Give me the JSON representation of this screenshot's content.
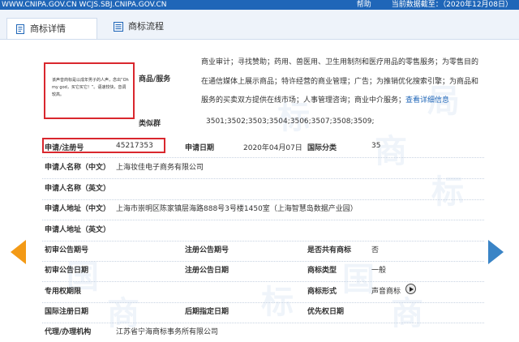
{
  "topbar": {
    "sites": "WWW.CNIPA.GOV.CN WCJS.SBJ.CNIPA.GOV.CN",
    "help": "帮助",
    "data_date": "当前数据截至：（2020年12月08日）"
  },
  "tabs": [
    {
      "label": "商标详情",
      "icon": "document-icon"
    },
    {
      "label": "商标流程",
      "icon": "list-icon"
    }
  ],
  "watermark": {
    "chars": [
      "标",
      "局",
      "商",
      "标",
      "国",
      "商",
      "标",
      "国",
      "商"
    ]
  },
  "trademark": {
    "sound_description": "该声音商标是以成年男子的人声，念出“Oh my god，买它买它！”。语速较快，音调较高。",
    "goods_label": "商品/服务",
    "goods_text": "商业审计；寻找赞助；药用、兽医用、卫生用制剂和医疗用品的零售服务；为零售目的在通信媒体上展示商品；特许经营的商业管理；广告；为推销优化搜索引擎；为商品和服务的买卖双方提供在线市场；人事管理咨询；商业中介服务；",
    "goods_link": "查看详细信息",
    "similar_group_label": "类似群",
    "similar_group_value": "3501;3502;3503;3504;3506;3507;3508;3509;",
    "reg_no_label": "申请/注册号",
    "reg_no_value": "45217353",
    "app_date_label": "申请日期",
    "app_date_value": "2020年04月07日",
    "intl_class_label": "国际分类",
    "intl_class_value": "35",
    "applicant_cn_label": "申请人名称（中文）",
    "applicant_cn_value": "上海妆佳电子商务有限公司",
    "applicant_en_label": "申请人名称（英文）",
    "address_cn_label": "申请人地址（中文）",
    "address_cn_value": "上海市崇明区陈家镇层海路888号3号楼1450室（上海智慧岛数据产业园）",
    "address_en_label": "申请人地址（英文）",
    "first_pub_no_label": "初审公告期号",
    "reg_pub_no_label": "注册公告期号",
    "shared_label": "是否共有商标",
    "shared_value": "否",
    "first_pub_date_label": "初审公告日期",
    "reg_pub_date_label": "注册公告日期",
    "tm_type_label": "商标类型",
    "tm_type_value": "一般",
    "exclusive_period_label": "专用权期限",
    "tm_form_label": "商标形式",
    "tm_form_value": "声音商标",
    "intl_reg_date_label": "国际注册日期",
    "later_date_label": "后期指定日期",
    "priority_date_label": "优先权日期",
    "agent_label": "代理/办理机构",
    "agent_value": "江苏省宁海商标事务所有限公司"
  },
  "colors": {
    "header_blue": "#1f66b8",
    "highlight_red": "#d9272e",
    "arrow_orange": "#f39a16",
    "arrow_blue": "#3a84c6",
    "link_blue": "#1f66b8"
  }
}
